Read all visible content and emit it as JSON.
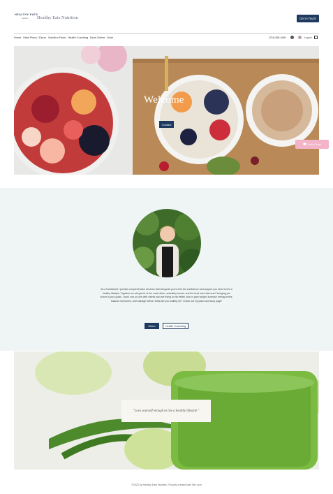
{
  "header": {
    "logo_line1": "HEALTHY EATS",
    "logo_line2": "Nutrition",
    "site_title": "Healthy Eats Nutrition",
    "cta_label": "Get In Touch"
  },
  "nav": {
    "items": [
      "Home",
      "Meal Plans / Decor",
      "Nutrition Facts",
      "Health Coaching",
      "Book Online",
      "More"
    ],
    "phone": "(734) 555-4900",
    "login_label": "Log In"
  },
  "hero": {
    "title": "Welcome",
    "contact_label": "Contact",
    "chat_label": "Let's Chat!"
  },
  "about": {
    "bio": "As a Nutritionist I provide comprehensive services that will guide you to find the confidence and support you need to live a healthy lifestyle. Together we will get rid of the crash diets, unhealthy trends, and the food rules that aren't bringing you closer to your goals. I work one-on-one with clients who are trying to eat better, lose or gain weight, increase energy levels, balance hormones, and manage stress. What are you waiting for? Check out my plans and shop page!",
    "menu_label": "Menu",
    "health_label": "Health Coaching"
  },
  "banner": {
    "quote": "\"Love yourself enough to live a healthy lifestyle.\""
  },
  "footer": {
    "text": "©2023 by Healthy Eats Nutrition. Proudly created with Wix.com"
  },
  "colors": {
    "brand_navy": "#1f3a5f",
    "chat_pink": "#f3b4c8",
    "about_bg": "#eff5f5"
  }
}
